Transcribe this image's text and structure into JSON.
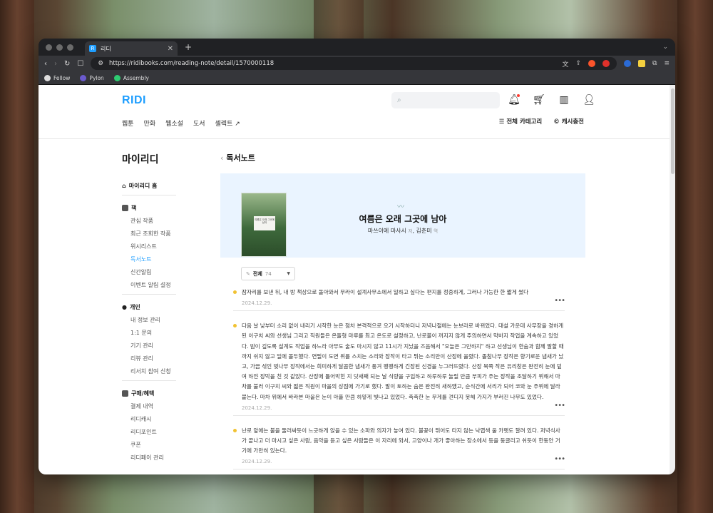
{
  "browser": {
    "tab_title": "리디",
    "tab_favicon": "R",
    "url": "https://ridibooks.com/reading-note/detail/1570000118",
    "bookmarks": [
      {
        "label": "Fellow"
      },
      {
        "label": "Pylon"
      },
      {
        "label": "Assembly"
      }
    ]
  },
  "header": {
    "logo": "RIDI",
    "search_placeholder": "",
    "gnb": [
      "웹툰",
      "만화",
      "웹소설",
      "도서",
      "셀렉트"
    ],
    "all_categories": "전체 카테고리",
    "cash_charge": "캐시충전"
  },
  "sidebar": {
    "title": "마이리디",
    "home": "마이리디 홈",
    "sections": [
      {
        "label": "책",
        "items": [
          "관심 작품",
          "최근 조회한 작품",
          "위시리스트",
          "독서노트",
          "신간알림",
          "이벤트 알림 설정"
        ],
        "active": 3
      },
      {
        "label": "개인",
        "items": [
          "내 정보 관리",
          "1:1 문의",
          "기기 관리",
          "리뷰 관리",
          "리서치 참여 신청"
        ]
      },
      {
        "label": "구매/혜택",
        "items": [
          "결제 내역",
          "리디캐시",
          "리디포인트",
          "쿠폰",
          "리디페이 관리"
        ]
      }
    ]
  },
  "main": {
    "breadcrumb": "독서노트",
    "book": {
      "title": "여름은 오래 그곳에 남아",
      "author": "마쓰이에 마사시",
      "author_role": "저",
      "translator": "김춘미",
      "translator_role": "역",
      "cover_text": "여름은 오래 그곳에 남아"
    },
    "filter": {
      "label": "전체",
      "count": "74"
    },
    "notes": [
      {
        "text": "잠자리를 보낸 뒤, 내 방 책상으로 돌아와서 무라이 설계사무소에서 일하고 싶다는 편지를 정중하게, 그러나 가능한 한 짧게 썼다",
        "date": "2024.12.29."
      },
      {
        "text": "다음 날 낮부터 소리 없이 내리기 시작한 눈은 점차 본격적으로 오기 시작하더니 저녁나절에는 눈보라로 바뀌었다. 대설 가운데 사무장을 경하게 된 이구치 씨와 선생님 그리고 직원들은 온돌형 마루를 최고 온도로 설정하고, 난로불이 꺼지지 않게 주의하면서 막바지 작업을 계속하고 있었다. 밤이 깊도록 설계도 작업을 하느라 아무도 술도 마시지 않고 11시가 지났을 즈음해서 \"오늘은 그만하지\" 하고 선생님이 한숨과 함께 말할 때까지 쉬지 않고 일에 몰두했다. 연필이 도면 위를 스치는 소리와 장작이 타고 튀는 소리만이 산장에 울렸다. 졸참나무 장작은 향기로운 냄새가 났고, 가끔 섞인 벚나무 장작에서는 희미하게 달콤한 냄새가 풍겨 팽팽하게 긴장된 신경을 누그러뜨렸다. 산장 북쪽 작은 유리창은 완전히 눈에 덮여 하얀 장막을 친 것 같았다. 산장에 틀어박힌 지 닷새째 되는 날 식량을 구입하고 하루하루 눌릴 만큼 부피가 주는 장작을 조달하기 위해서 마차를 불러 이구치 씨와 젊은 직원이 마을의 상점에 가기로 했다. 말이 토하는 숨은 완전히 새하얬고, 순식간에 서리가 되어 코와 눈 주위에 달라붙는다. 마차 위에서 바라본 마을은 눈이 아플 만큼 하얗게 빛나고 있었다. 축축한 눈 무게를 견디지 못해 가지가 부러진 나무도 있었다.",
        "date": "2024.12.29."
      },
      {
        "text": "난로 앞에는 불을 둘러싸듯이 느긋하게 앉을 수 있는 소파와 의자가 놓여 있다. 불꽃이 튀어도 타지 않는 낙엽색 울 카펫도 깔려 있다. 저녁식사가 끝나고 더 마시고 싶은 사람, 음악을 듣고 싶은 사람들은 이 자리에 와서, 고양이나 개가 좋아하는 장소에서 등을 둥글리고 쉬듯이 한동안 거기에 가만히 있는다.",
        "date": "2024.12.29."
      }
    ]
  }
}
